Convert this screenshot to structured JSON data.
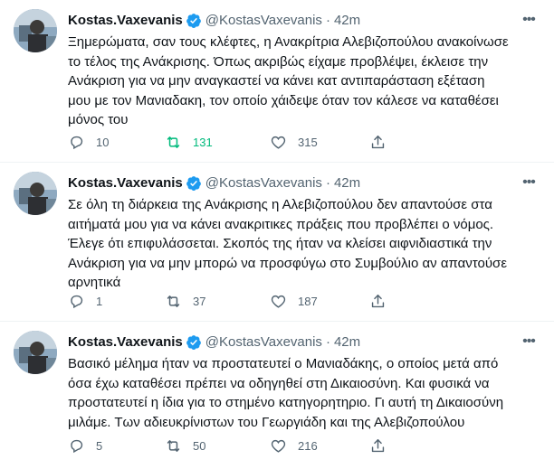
{
  "colors": {
    "accent": "#1d9bf0",
    "retweet_active": "#00ba7c",
    "secondary": "#536471"
  },
  "tweets": [
    {
      "author": "Kostas.Vaxevanis",
      "handle": "@KostasVaxevanis",
      "separator": "·",
      "time": "42m",
      "text": "Ξημερώματα, σαν τους κλέφτες, η Ανακρίτρια Αλεβιζοπούλου ανακοίνωσε\nτο τέλος της Ανάκρισης. Όπως ακριβώς είχαμε προβλέψει, έκλεισε την\nΑνάκριση για να μην αναγκαστεί να κάνει κατ αντιπαράσταση εξέταση\nμου με τον Μανιαδακη, τον οποίο χάιδεψε όταν τον κάλεσε να καταθέσει\nμόνος του",
      "replies": "10",
      "retweets": "131",
      "retweeted": true,
      "likes": "315"
    },
    {
      "author": "Kostas.Vaxevanis",
      "handle": "@KostasVaxevanis",
      "separator": "·",
      "time": "42m",
      "text": "Σε όλη τη διάρκεια της Ανάκρισης η  Αλεβιζοπούλου δεν απαντούσε στα\nαιτήματά μου για να κάνει ανακριτικες πράξεις που προβλέπει ο νόμος.\nΈλεγε ότι επιφυλάσσεται. Σκοπός της ήταν να κλείσει αιφνιδιαστικά την\nΑνάκριση για να μην μπορώ να προσφύγω στο Συμβούλιο αν απαντούσε\nαρνητικά",
      "replies": "1",
      "retweets": "37",
      "retweeted": false,
      "likes": "187"
    },
    {
      "author": "Kostas.Vaxevanis",
      "handle": "@KostasVaxevanis",
      "separator": "·",
      "time": "42m",
      "text": "Βασικό μέλημα ήταν να προστατευτεί ο Μανιαδάκης, ο οποίος μετά από\nόσα έχω καταθέσει πρέπει να οδηγηθεί στη Δικαιοσύνη. Και φυσικά να\nπροστατευτεί η ίδια για το στημένο κατηγορητηριο. Γι αυτή τη Δικαιοσύνη\nμιλάμε. Των αδιευκρίνιστων του Γεωργιάδη και της Αλεβιζοπούλου",
      "replies": "5",
      "retweets": "50",
      "retweeted": false,
      "likes": "216"
    }
  ]
}
